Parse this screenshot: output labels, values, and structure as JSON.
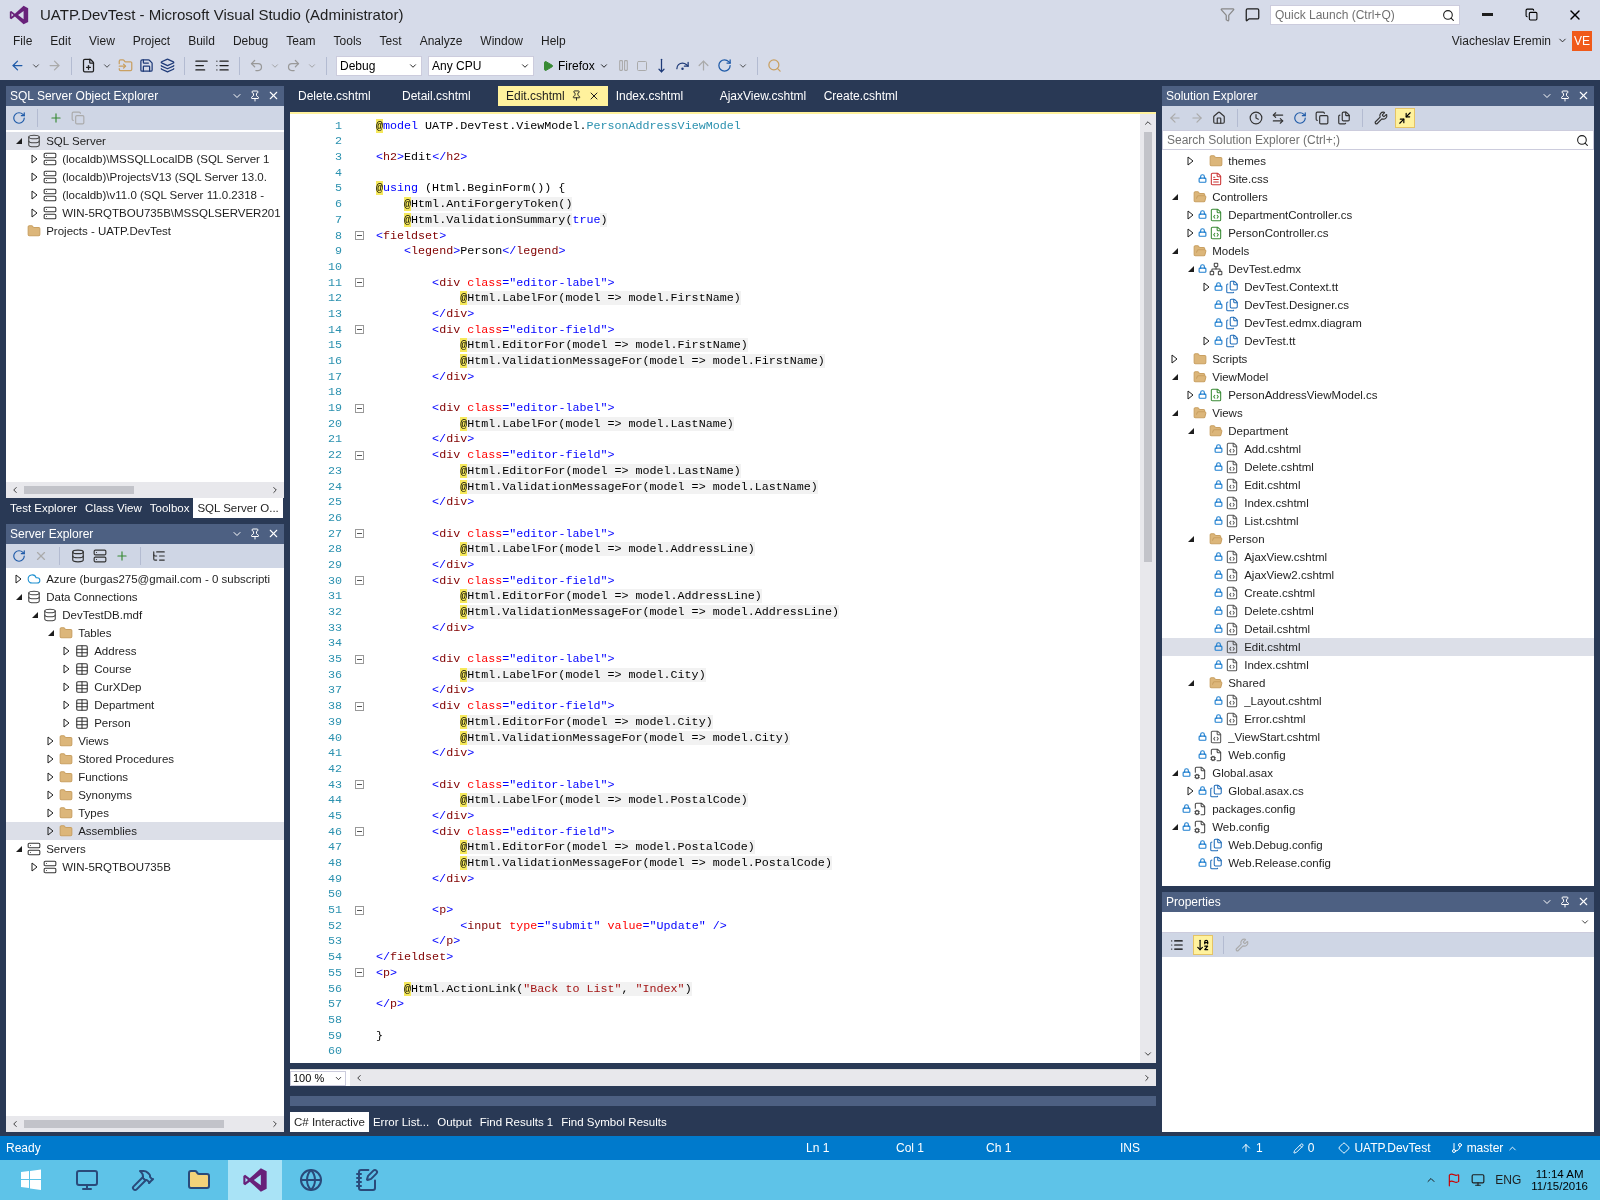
{
  "window": {
    "title": "UATP.DevTest - Microsoft Visual Studio (Administrator)",
    "quick_launch": {
      "placeholder": "Quick Launch (Ctrl+Q)"
    }
  },
  "menu": [
    "File",
    "Edit",
    "View",
    "Project",
    "Build",
    "Debug",
    "Team",
    "Tools",
    "Test",
    "Analyze",
    "Window",
    "Help"
  ],
  "account": {
    "name": "Viacheslav Eremin",
    "initials": "VE"
  },
  "toolbar": {
    "configuration": "Debug",
    "platform": "Any CPU",
    "run_target": "Firefox"
  },
  "sql_object_explorer": {
    "title": "SQL Server Object Explorer",
    "tree": [
      {
        "label": "SQL Server",
        "kind": "sqlserver",
        "expanded": true,
        "selected": true,
        "children": [
          {
            "label": "(localdb)\\MSSQLLocalDB (SQL Server 1",
            "kind": "server",
            "expanded": false,
            "selected": false
          },
          {
            "label": "(localdb)\\ProjectsV13 (SQL Server 13.0.",
            "kind": "server",
            "expanded": false,
            "selected": false
          },
          {
            "label": "(localdb)\\v11.0 (SQL Server 11.0.2318 -",
            "kind": "server",
            "expanded": false,
            "selected": false
          },
          {
            "label": "WIN-5RQTBOU735B\\MSSQLSERVER201",
            "kind": "server",
            "expanded": false,
            "selected": false
          }
        ]
      },
      {
        "label": "Projects - UATP.DevTest",
        "kind": "folder",
        "selected": false
      }
    ],
    "tabs": [
      {
        "label": "Test Explorer",
        "selected": false
      },
      {
        "label": "Class View",
        "selected": false
      },
      {
        "label": "Toolbox",
        "selected": false
      },
      {
        "label": "SQL Server O...",
        "selected": true
      }
    ]
  },
  "server_explorer": {
    "title": "Server Explorer",
    "tree": [
      {
        "label": "Azure (burgas275@gmail.com - 0 subscripti",
        "kind": "cloud",
        "expanded": false,
        "selected": false
      },
      {
        "label": "Data Connections",
        "kind": "databases",
        "expanded": true,
        "selected": false,
        "children": [
          {
            "label": "DevTestDB.mdf",
            "kind": "database",
            "expanded": true,
            "selected": false,
            "children": [
              {
                "label": "Tables",
                "kind": "folder",
                "expanded": true,
                "selected": false,
                "children": [
                  {
                    "label": "Address",
                    "kind": "table",
                    "expanded": false,
                    "selected": false
                  },
                  {
                    "label": "Course",
                    "kind": "table",
                    "expanded": false,
                    "selected": false
                  },
                  {
                    "label": "CurXDep",
                    "kind": "table",
                    "expanded": false,
                    "selected": false
                  },
                  {
                    "label": "Department",
                    "kind": "table",
                    "expanded": false,
                    "selected": false
                  },
                  {
                    "label": "Person",
                    "kind": "table",
                    "expanded": false,
                    "selected": false
                  }
                ]
              },
              {
                "label": "Views",
                "kind": "folder",
                "expanded": false,
                "selected": false
              },
              {
                "label": "Stored Procedures",
                "kind": "folder",
                "expanded": false,
                "selected": false
              },
              {
                "label": "Functions",
                "kind": "folder",
                "expanded": false,
                "selected": false
              },
              {
                "label": "Synonyms",
                "kind": "folder",
                "expanded": false,
                "selected": false
              },
              {
                "label": "Types",
                "kind": "folder",
                "expanded": false,
                "selected": false
              },
              {
                "label": "Assemblies",
                "kind": "folder",
                "expanded": false,
                "selected": true
              }
            ]
          }
        ]
      },
      {
        "label": "Servers",
        "kind": "servers",
        "expanded": true,
        "selected": false,
        "children": [
          {
            "label": "WIN-5RQTBOU735B",
            "kind": "server",
            "expanded": false,
            "selected": false
          }
        ]
      }
    ]
  },
  "documents": [
    {
      "label": "Delete.cshtml",
      "selected": false
    },
    {
      "label": "Detail.cshtml",
      "selected": false
    },
    {
      "label": "Edit.cshtml",
      "selected": true
    },
    {
      "label": "Index.cshtml",
      "selected": false
    },
    {
      "label": "AjaxView.cshtml",
      "selected": false
    },
    {
      "label": "Create.cshtml",
      "selected": false
    }
  ],
  "editor": {
    "zoom": "100 %",
    "lines": [
      {
        "number": "1",
        "fold": false,
        "tokens": [
          {
            "kind": "razor",
            "text": "@"
          },
          {
            "kind": "kw",
            "text": "model"
          },
          {
            "kind": "plain",
            "text": " UATP.DevTest.ViewModel."
          },
          {
            "kind": "type",
            "text": "PersonAddressViewModel"
          }
        ]
      },
      {
        "number": "2",
        "fold": false
      },
      {
        "number": "3",
        "fold": false,
        "tokens": [
          {
            "kind": "punct",
            "text": "<"
          },
          {
            "kind": "elem",
            "text": "h2"
          },
          {
            "kind": "punct",
            "text": ">"
          },
          {
            "kind": "plain",
            "text": "Edit"
          },
          {
            "kind": "punct",
            "text": "</"
          },
          {
            "kind": "elem",
            "text": "h2"
          },
          {
            "kind": "punct",
            "text": ">"
          }
        ]
      },
      {
        "number": "4",
        "fold": false
      },
      {
        "number": "5",
        "fold": false,
        "tokens": [
          {
            "kind": "razor",
            "text": "@"
          },
          {
            "kind": "kw",
            "text": "using"
          },
          {
            "kind": "plain",
            "text": " (Html.BeginForm()) {"
          }
        ]
      },
      {
        "number": "6",
        "fold": false,
        "tokens": [
          {
            "kind": "razor",
            "text": "    @"
          },
          {
            "kind": "expr",
            "text": "Html.AntiForgeryToken()"
          }
        ]
      },
      {
        "number": "7",
        "fold": false,
        "tokens": [
          {
            "kind": "razor",
            "text": "    @"
          },
          {
            "kind": "expr",
            "text": "Html.ValidationSummary("
          },
          {
            "kind": "kw",
            "text": "true"
          },
          {
            "kind": "expr",
            "text": ")"
          }
        ]
      },
      {
        "number": "8",
        "fold": true,
        "tokens": [
          {
            "kind": "punct",
            "text": "<"
          },
          {
            "kind": "elem",
            "text": "fieldset"
          },
          {
            "kind": "punct",
            "text": ">"
          }
        ]
      },
      {
        "number": "9",
        "fold": false,
        "tokens": [
          {
            "kind": "punct",
            "text": "    <"
          },
          {
            "kind": "elem",
            "text": "legend"
          },
          {
            "kind": "punct",
            "text": ">"
          },
          {
            "kind": "plain",
            "text": "Person"
          },
          {
            "kind": "punct",
            "text": "</"
          },
          {
            "kind": "elem",
            "text": "legend"
          },
          {
            "kind": "punct",
            "text": ">"
          }
        ]
      },
      {
        "number": "10",
        "fold": false
      },
      {
        "number": "11",
        "fold": true,
        "tokens": [
          {
            "kind": "punct",
            "text": "        <"
          },
          {
            "kind": "elem",
            "text": "div"
          },
          {
            "kind": "attr",
            "text": " class"
          },
          {
            "kind": "punct",
            "text": "="
          },
          {
            "kind": "str",
            "text": "\"editor-label\""
          },
          {
            "kind": "punct",
            "text": ">"
          }
        ]
      },
      {
        "number": "12",
        "fold": false,
        "tokens": [
          {
            "kind": "razor",
            "text": "            @"
          },
          {
            "kind": "expr",
            "text": "Html.LabelFor(model => model.FirstName)"
          }
        ]
      },
      {
        "number": "13",
        "fold": false,
        "tokens": [
          {
            "kind": "punct",
            "text": "        </"
          },
          {
            "kind": "elem",
            "text": "div"
          },
          {
            "kind": "punct",
            "text": ">"
          }
        ]
      },
      {
        "number": "14",
        "fold": true,
        "tokens": [
          {
            "kind": "punct",
            "text": "        <"
          },
          {
            "kind": "elem",
            "text": "div"
          },
          {
            "kind": "attr",
            "text": " class"
          },
          {
            "kind": "punct",
            "text": "="
          },
          {
            "kind": "str",
            "text": "\"editor-field\""
          },
          {
            "kind": "punct",
            "text": ">"
          }
        ]
      },
      {
        "number": "15",
        "fold": false,
        "tokens": [
          {
            "kind": "razor",
            "text": "            @"
          },
          {
            "kind": "expr",
            "text": "Html.EditorFor(model => model.FirstName)"
          }
        ]
      },
      {
        "number": "16",
        "fold": false,
        "tokens": [
          {
            "kind": "razor",
            "text": "            @"
          },
          {
            "kind": "expr",
            "text": "Html.ValidationMessageFor(model => model.FirstName)"
          }
        ]
      },
      {
        "number": "17",
        "fold": false,
        "tokens": [
          {
            "kind": "punct",
            "text": "        </"
          },
          {
            "kind": "elem",
            "text": "div"
          },
          {
            "kind": "punct",
            "text": ">"
          }
        ]
      },
      {
        "number": "18",
        "fold": false
      },
      {
        "number": "19",
        "fold": true,
        "tokens": [
          {
            "kind": "punct",
            "text": "        <"
          },
          {
            "kind": "elem",
            "text": "div"
          },
          {
            "kind": "attr",
            "text": " class"
          },
          {
            "kind": "punct",
            "text": "="
          },
          {
            "kind": "str",
            "text": "\"editor-label\""
          },
          {
            "kind": "punct",
            "text": ">"
          }
        ]
      },
      {
        "number": "20",
        "fold": false,
        "tokens": [
          {
            "kind": "razor",
            "text": "            @"
          },
          {
            "kind": "expr",
            "text": "Html.LabelFor(model => model.LastName)"
          }
        ]
      },
      {
        "number": "21",
        "fold": false,
        "tokens": [
          {
            "kind": "punct",
            "text": "        </"
          },
          {
            "kind": "elem",
            "text": "div"
          },
          {
            "kind": "punct",
            "text": ">"
          }
        ]
      },
      {
        "number": "22",
        "fold": true,
        "tokens": [
          {
            "kind": "punct",
            "text": "        <"
          },
          {
            "kind": "elem",
            "text": "div"
          },
          {
            "kind": "attr",
            "text": " class"
          },
          {
            "kind": "punct",
            "text": "="
          },
          {
            "kind": "str",
            "text": "\"editor-field\""
          },
          {
            "kind": "punct",
            "text": ">"
          }
        ]
      },
      {
        "number": "23",
        "fold": false,
        "tokens": [
          {
            "kind": "razor",
            "text": "            @"
          },
          {
            "kind": "expr",
            "text": "Html.EditorFor(model => model.LastName)"
          }
        ]
      },
      {
        "number": "24",
        "fold": false,
        "tokens": [
          {
            "kind": "razor",
            "text": "            @"
          },
          {
            "kind": "expr",
            "text": "Html.ValidationMessageFor(model => model.LastName)"
          }
        ]
      },
      {
        "number": "25",
        "fold": false,
        "tokens": [
          {
            "kind": "punct",
            "text": "        </"
          },
          {
            "kind": "elem",
            "text": "div"
          },
          {
            "kind": "punct",
            "text": ">"
          }
        ]
      },
      {
        "number": "26",
        "fold": false
      },
      {
        "number": "27",
        "fold": true,
        "tokens": [
          {
            "kind": "punct",
            "text": "        <"
          },
          {
            "kind": "elem",
            "text": "div"
          },
          {
            "kind": "attr",
            "text": " class"
          },
          {
            "kind": "punct",
            "text": "="
          },
          {
            "kind": "str",
            "text": "\"editor-label\""
          },
          {
            "kind": "punct",
            "text": ">"
          }
        ]
      },
      {
        "number": "28",
        "fold": false,
        "tokens": [
          {
            "kind": "razor",
            "text": "            @"
          },
          {
            "kind": "expr",
            "text": "Html.LabelFor(model => model.AddressLine)"
          }
        ]
      },
      {
        "number": "29",
        "fold": false,
        "tokens": [
          {
            "kind": "punct",
            "text": "        </"
          },
          {
            "kind": "elem",
            "text": "div"
          },
          {
            "kind": "punct",
            "text": ">"
          }
        ]
      },
      {
        "number": "30",
        "fold": true,
        "tokens": [
          {
            "kind": "punct",
            "text": "        <"
          },
          {
            "kind": "elem",
            "text": "div"
          },
          {
            "kind": "attr",
            "text": " class"
          },
          {
            "kind": "punct",
            "text": "="
          },
          {
            "kind": "str",
            "text": "\"editor-field\""
          },
          {
            "kind": "punct",
            "text": ">"
          }
        ]
      },
      {
        "number": "31",
        "fold": false,
        "tokens": [
          {
            "kind": "razor",
            "text": "            @"
          },
          {
            "kind": "expr",
            "text": "Html.EditorFor(model => model.AddressLine)"
          }
        ]
      },
      {
        "number": "32",
        "fold": false,
        "tokens": [
          {
            "kind": "razor",
            "text": "            @"
          },
          {
            "kind": "expr",
            "text": "Html.ValidationMessageFor(model => model.AddressLine)"
          }
        ]
      },
      {
        "number": "33",
        "fold": false,
        "tokens": [
          {
            "kind": "punct",
            "text": "        </"
          },
          {
            "kind": "elem",
            "text": "div"
          },
          {
            "kind": "punct",
            "text": ">"
          }
        ]
      },
      {
        "number": "34",
        "fold": false
      },
      {
        "number": "35",
        "fold": true,
        "tokens": [
          {
            "kind": "punct",
            "text": "        <"
          },
          {
            "kind": "elem",
            "text": "div"
          },
          {
            "kind": "attr",
            "text": " class"
          },
          {
            "kind": "punct",
            "text": "="
          },
          {
            "kind": "str",
            "text": "\"editor-label\""
          },
          {
            "kind": "punct",
            "text": ">"
          }
        ]
      },
      {
        "number": "36",
        "fold": false,
        "tokens": [
          {
            "kind": "razor",
            "text": "            @"
          },
          {
            "kind": "expr",
            "text": "Html.LabelFor(model => model.City)"
          }
        ]
      },
      {
        "number": "37",
        "fold": false,
        "tokens": [
          {
            "kind": "punct",
            "text": "        </"
          },
          {
            "kind": "elem",
            "text": "div"
          },
          {
            "kind": "punct",
            "text": ">"
          }
        ]
      },
      {
        "number": "38",
        "fold": true,
        "tokens": [
          {
            "kind": "punct",
            "text": "        <"
          },
          {
            "kind": "elem",
            "text": "div"
          },
          {
            "kind": "attr",
            "text": " class"
          },
          {
            "kind": "punct",
            "text": "="
          },
          {
            "kind": "str",
            "text": "\"editor-field\""
          },
          {
            "kind": "punct",
            "text": ">"
          }
        ]
      },
      {
        "number": "39",
        "fold": false,
        "tokens": [
          {
            "kind": "razor",
            "text": "            @"
          },
          {
            "kind": "expr",
            "text": "Html.EditorFor(model => model.City)"
          }
        ]
      },
      {
        "number": "40",
        "fold": false,
        "tokens": [
          {
            "kind": "razor",
            "text": "            @"
          },
          {
            "kind": "expr",
            "text": "Html.ValidationMessageFor(model => model.City)"
          }
        ]
      },
      {
        "number": "41",
        "fold": false,
        "tokens": [
          {
            "kind": "punct",
            "text": "        </"
          },
          {
            "kind": "elem",
            "text": "div"
          },
          {
            "kind": "punct",
            "text": ">"
          }
        ]
      },
      {
        "number": "42",
        "fold": false
      },
      {
        "number": "43",
        "fold": true,
        "tokens": [
          {
            "kind": "punct",
            "text": "        <"
          },
          {
            "kind": "elem",
            "text": "div"
          },
          {
            "kind": "attr",
            "text": " class"
          },
          {
            "kind": "punct",
            "text": "="
          },
          {
            "kind": "str",
            "text": "\"editor-label\""
          },
          {
            "kind": "punct",
            "text": ">"
          }
        ]
      },
      {
        "number": "44",
        "fold": false,
        "tokens": [
          {
            "kind": "razor",
            "text": "            @"
          },
          {
            "kind": "expr",
            "text": "Html.LabelFor(model => model.PostalCode)"
          }
        ]
      },
      {
        "number": "45",
        "fold": false,
        "tokens": [
          {
            "kind": "punct",
            "text": "        </"
          },
          {
            "kind": "elem",
            "text": "div"
          },
          {
            "kind": "punct",
            "text": ">"
          }
        ]
      },
      {
        "number": "46",
        "fold": true,
        "tokens": [
          {
            "kind": "punct",
            "text": "        <"
          },
          {
            "kind": "elem",
            "text": "div"
          },
          {
            "kind": "attr",
            "text": " class"
          },
          {
            "kind": "punct",
            "text": "="
          },
          {
            "kind": "str",
            "text": "\"editor-field\""
          },
          {
            "kind": "punct",
            "text": ">"
          }
        ]
      },
      {
        "number": "47",
        "fold": false,
        "tokens": [
          {
            "kind": "razor",
            "text": "            @"
          },
          {
            "kind": "expr",
            "text": "Html.EditorFor(model => model.PostalCode)"
          }
        ]
      },
      {
        "number": "48",
        "fold": false,
        "tokens": [
          {
            "kind": "razor",
            "text": "            @"
          },
          {
            "kind": "expr",
            "text": "Html.ValidationMessageFor(model => model.PostalCode)"
          }
        ]
      },
      {
        "number": "49",
        "fold": false,
        "tokens": [
          {
            "kind": "punct",
            "text": "        </"
          },
          {
            "kind": "elem",
            "text": "div"
          },
          {
            "kind": "punct",
            "text": ">"
          }
        ]
      },
      {
        "number": "50",
        "fold": false
      },
      {
        "number": "51",
        "fold": true,
        "tokens": [
          {
            "kind": "punct",
            "text": "        <"
          },
          {
            "kind": "elem",
            "text": "p"
          },
          {
            "kind": "punct",
            "text": ">"
          }
        ]
      },
      {
        "number": "52",
        "fold": false,
        "tokens": [
          {
            "kind": "punct",
            "text": "            <"
          },
          {
            "kind": "elem",
            "text": "input"
          },
          {
            "kind": "attr",
            "text": " type"
          },
          {
            "kind": "punct",
            "text": "="
          },
          {
            "kind": "str",
            "text": "\"submit\""
          },
          {
            "kind": "attr",
            "text": " value"
          },
          {
            "kind": "punct",
            "text": "="
          },
          {
            "kind": "str",
            "text": "\"Update\""
          },
          {
            "kind": "punct",
            "text": " />"
          }
        ]
      },
      {
        "number": "53",
        "fold": false,
        "tokens": [
          {
            "kind": "punct",
            "text": "        </"
          },
          {
            "kind": "elem",
            "text": "p"
          },
          {
            "kind": "punct",
            "text": ">"
          }
        ]
      },
      {
        "number": "54",
        "fold": false,
        "tokens": [
          {
            "kind": "punct",
            "text": "</"
          },
          {
            "kind": "elem",
            "text": "fieldset"
          },
          {
            "kind": "punct",
            "text": ">"
          }
        ]
      },
      {
        "number": "55",
        "fold": true,
        "tokens": [
          {
            "kind": "punct",
            "text": "<"
          },
          {
            "kind": "elem",
            "text": "p"
          },
          {
            "kind": "punct",
            "text": ">"
          }
        ]
      },
      {
        "number": "56",
        "fold": false,
        "tokens": [
          {
            "kind": "razor",
            "text": "    @"
          },
          {
            "kind": "expr",
            "text": "Html.ActionLink("
          },
          {
            "kind": "cstr",
            "text": "\"Back to List\""
          },
          {
            "kind": "expr",
            "text": ", "
          },
          {
            "kind": "cstr",
            "text": "\"Index\""
          },
          {
            "kind": "expr",
            "text": ")"
          }
        ]
      },
      {
        "number": "57",
        "fold": false,
        "tokens": [
          {
            "kind": "punct",
            "text": "</"
          },
          {
            "kind": "elem",
            "text": "p"
          },
          {
            "kind": "punct",
            "text": ">"
          }
        ]
      },
      {
        "number": "58",
        "fold": false
      },
      {
        "number": "59",
        "fold": false,
        "tokens": [
          {
            "kind": "plain",
            "text": "}"
          }
        ]
      },
      {
        "number": "60",
        "fold": false
      }
    ]
  },
  "tool_tabs": [
    {
      "label": "C# Interactive",
      "selected": true
    },
    {
      "label": "Error List...",
      "selected": false
    },
    {
      "label": "Output",
      "selected": false
    },
    {
      "label": "Find Results 1",
      "selected": false
    },
    {
      "label": "Find Symbol Results",
      "selected": false
    }
  ],
  "solution_explorer": {
    "title": "Solution Explorer",
    "preview_selected": true,
    "search": {
      "placeholder": "Search Solution Explorer (Ctrl+;)"
    },
    "tree": [
      {
        "children": [
          {
            "label": "themes",
            "kind": "folder",
            "expanded": false,
            "locked": false,
            "selected": false
          },
          {
            "label": "Site.css",
            "kind": "css",
            "locked": true,
            "selected": false
          }
        ]
      },
      {
        "label": "Controllers",
        "kind": "folder-open",
        "expanded": true,
        "locked": false,
        "selected": false,
        "children": [
          {
            "label": "DepartmentController.cs",
            "kind": "cs",
            "expanded": false,
            "locked": true,
            "selected": false
          },
          {
            "label": "PersonController.cs",
            "kind": "cs",
            "expanded": false,
            "locked": true,
            "selected": false
          }
        ]
      },
      {
        "label": "Models",
        "kind": "folder-open",
        "expanded": true,
        "locked": false,
        "selected": false,
        "children": [
          {
            "label": "DevTest.edmx",
            "kind": "edmx",
            "expanded": true,
            "locked": true,
            "selected": false,
            "children": [
              {
                "label": "DevTest.Context.tt",
                "kind": "tt",
                "expanded": false,
                "locked": true,
                "selected": false
              },
              {
                "label": "DevTest.Designer.cs",
                "kind": "tt",
                "locked": true,
                "selected": false
              },
              {
                "label": "DevTest.edmx.diagram",
                "kind": "tt",
                "locked": true,
                "selected": false
              },
              {
                "label": "DevTest.tt",
                "kind": "tt",
                "expanded": false,
                "locked": true,
                "selected": false
              }
            ]
          }
        ]
      },
      {
        "label": "Scripts",
        "kind": "folder",
        "expanded": false,
        "locked": false,
        "selected": false
      },
      {
        "label": "ViewModel",
        "kind": "folder-open",
        "expanded": true,
        "locked": false,
        "selected": false,
        "children": [
          {
            "label": "PersonAddressViewModel.cs",
            "kind": "cs",
            "expanded": false,
            "locked": true,
            "selected": false
          }
        ]
      },
      {
        "label": "Views",
        "kind": "folder-open",
        "expanded": true,
        "locked": false,
        "selected": false,
        "children": [
          {
            "label": "Department",
            "kind": "folder-open",
            "expanded": true,
            "locked": false,
            "selected": false,
            "children": [
              {
                "label": "Add.cshtml",
                "kind": "cshtml",
                "locked": true,
                "selected": false
              },
              {
                "label": "Delete.cshtml",
                "kind": "cshtml",
                "locked": true,
                "selected": false
              },
              {
                "label": "Edit.cshtml",
                "kind": "cshtml",
                "locked": true,
                "selected": false
              },
              {
                "label": "Index.cshtml",
                "kind": "cshtml",
                "locked": true,
                "selected": false
              },
              {
                "label": "List.cshtml",
                "kind": "cshtml",
                "locked": true,
                "selected": false
              }
            ]
          },
          {
            "label": "Person",
            "kind": "folder-open",
            "expanded": true,
            "locked": false,
            "selected": false,
            "children": [
              {
                "label": "AjaxView.cshtml",
                "kind": "cshtml",
                "locked": true,
                "selected": false
              },
              {
                "label": "AjaxView2.cshtml",
                "kind": "cshtml",
                "locked": true,
                "selected": false
              },
              {
                "label": "Create.cshtml",
                "kind": "cshtml",
                "locked": true,
                "selected": false
              },
              {
                "label": "Delete.cshtml",
                "kind": "cshtml",
                "locked": true,
                "selected": false
              },
              {
                "label": "Detail.cshtml",
                "kind": "cshtml",
                "locked": true,
                "selected": false
              },
              {
                "label": "Edit.cshtml",
                "kind": "cshtml",
                "locked": true,
                "selected": true
              },
              {
                "label": "Index.cshtml",
                "kind": "cshtml",
                "locked": true,
                "selected": false
              }
            ]
          },
          {
            "label": "Shared",
            "kind": "folder-open",
            "expanded": true,
            "locked": false,
            "selected": false,
            "children": [
              {
                "label": "_Layout.cshtml",
                "kind": "cshtml",
                "locked": true,
                "selected": false
              },
              {
                "label": "Error.cshtml",
                "kind": "cshtml",
                "locked": true,
                "selected": false
              }
            ]
          },
          {
            "label": "_ViewStart.cshtml",
            "kind": "cshtml",
            "locked": true,
            "selected": false
          },
          {
            "label": "Web.config",
            "kind": "config",
            "locked": true,
            "selected": false
          }
        ]
      },
      {
        "label": "Global.asax",
        "kind": "config",
        "expanded": true,
        "locked": true,
        "selected": false,
        "children": [
          {
            "label": "Global.asax.cs",
            "kind": "tt",
            "expanded": false,
            "locked": true,
            "selected": false
          }
        ]
      },
      {
        "label": "packages.config",
        "kind": "config",
        "locked": true,
        "selected": false
      },
      {
        "label": "Web.config",
        "kind": "config",
        "expanded": true,
        "locked": true,
        "selected": false,
        "children": [
          {
            "label": "Web.Debug.config",
            "kind": "tt",
            "locked": true,
            "selected": false
          },
          {
            "label": "Web.Release.config",
            "kind": "tt",
            "locked": true,
            "selected": false
          }
        ]
      }
    ]
  },
  "properties": {
    "title": "Properties",
    "views": [
      {
        "kind": "categorized",
        "selected": false
      },
      {
        "kind": "alphabetical",
        "selected": true
      }
    ]
  },
  "status_bar": {
    "message": "Ready",
    "line": "Ln 1",
    "column": "Col 1",
    "char": "Ch 1",
    "mode": "INS",
    "pushes": "1",
    "edits": "0",
    "repository": "UATP.DevTest",
    "branch": "master"
  },
  "taskbar": {
    "apps": [
      {
        "kind": "server",
        "active": false
      },
      {
        "kind": "tools",
        "active": false
      },
      {
        "kind": "folder",
        "active": false
      },
      {
        "kind": "studio",
        "active": true
      },
      {
        "kind": "browser",
        "active": false
      },
      {
        "kind": "notepad",
        "active": false
      }
    ],
    "language": "ENG",
    "time": "11:14 AM",
    "date": "11/15/2016"
  }
}
